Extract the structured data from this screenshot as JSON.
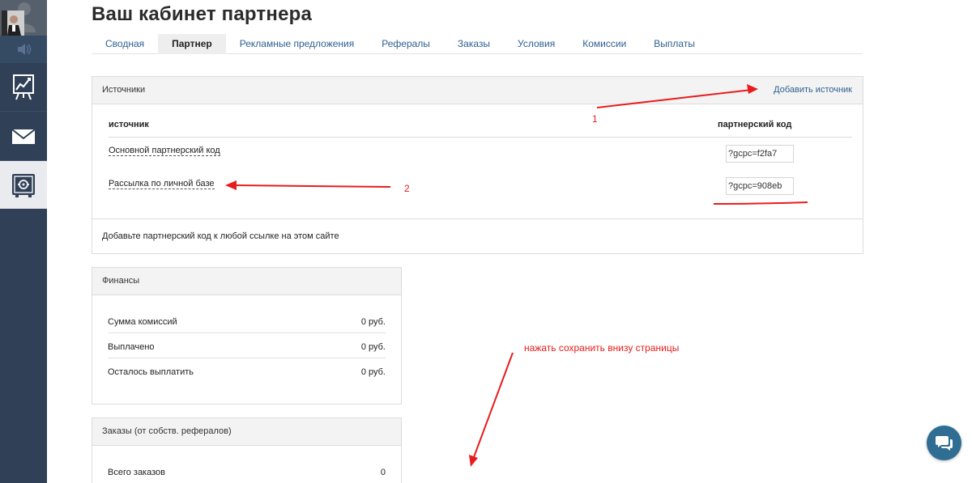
{
  "page": {
    "title": "Ваш кабинет партнера"
  },
  "tabs": [
    {
      "label": "Сводная",
      "active": false
    },
    {
      "label": "Партнер",
      "active": true
    },
    {
      "label": "Рекламные предложения",
      "active": false
    },
    {
      "label": "Рефералы",
      "active": false
    },
    {
      "label": "Заказы",
      "active": false
    },
    {
      "label": "Условия",
      "active": false
    },
    {
      "label": "Комиссии",
      "active": false
    },
    {
      "label": "Выплаты",
      "active": false
    }
  ],
  "sidebar": {
    "icons": [
      "avatar",
      "sound-icon",
      "chart-icon",
      "mail-icon",
      "safe-icon"
    ],
    "bg_color": "#2f4057",
    "active_bg_color": "#e9ebee"
  },
  "sources": {
    "title": "Источники",
    "add_label": "Добавить источник",
    "col_source": "источник",
    "col_code": "партнерский код",
    "rows": [
      {
        "name": "Основной партнерский код",
        "code": "?gcpc=f2fa7"
      },
      {
        "name": "Рассылка по личной базе",
        "code": "?gcpc=908eb"
      }
    ],
    "footer": "Добавьте партнерский код к любой ссылке на этом сайте"
  },
  "finance": {
    "title": "Финансы",
    "rows": [
      {
        "label": "Сумма комиссий",
        "value": "0 руб."
      },
      {
        "label": "Выплачено",
        "value": "0 руб."
      },
      {
        "label": "Осталось выплатить",
        "value": "0 руб."
      }
    ]
  },
  "orders": {
    "title": "Заказы (от собств. рефералов)",
    "rows": [
      {
        "label": "Всего заказов",
        "value": "0"
      }
    ]
  },
  "annotations": {
    "label_1": "1",
    "label_2": "2",
    "note": "нажать сохранить внизу страницы",
    "color": "#e81c1c"
  },
  "chat": {
    "icon": "chat-bubbles-icon",
    "color": "#2f6d93"
  }
}
